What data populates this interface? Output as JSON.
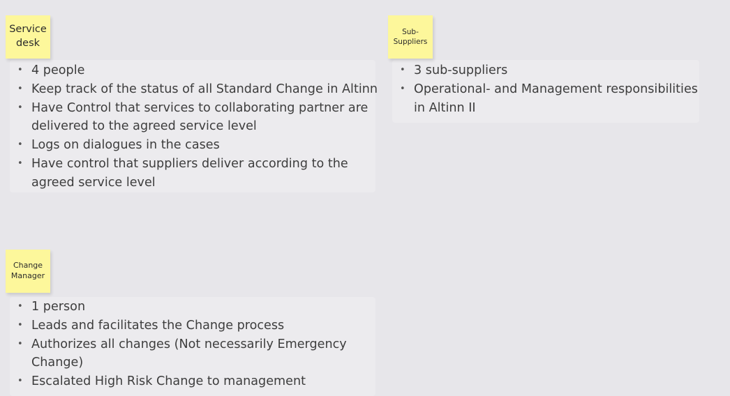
{
  "notes": {
    "service_desk": {
      "line1": "Service",
      "line2": "desk"
    },
    "sub_suppliers": {
      "line1": "Sub-",
      "line2": "Suppliers"
    },
    "change_manager": {
      "line1": "Change",
      "line2": "Manager"
    }
  },
  "lists": {
    "service_desk": [
      "4 people",
      "Keep track of the status of all Standard Change in Altinn",
      "Have Control that services to collaborating partner are delivered to the agreed service level",
      "Logs on dialogues in the cases",
      "Have control that suppliers deliver according to the agreed service level"
    ],
    "sub_suppliers": [
      "3 sub-suppliers",
      "Operational- and Management responsibilities in Altinn II"
    ],
    "change_manager": [
      "1 person",
      "Leads and facilitates the Change process",
      "Authorizes all changes (Not necessarily Emergency Change)",
      "Escalated High Risk Change to management"
    ]
  },
  "colors": {
    "canvas": "#e7e6ea",
    "sticky_note": "#fdf79b",
    "text": "#3d3d3d"
  }
}
